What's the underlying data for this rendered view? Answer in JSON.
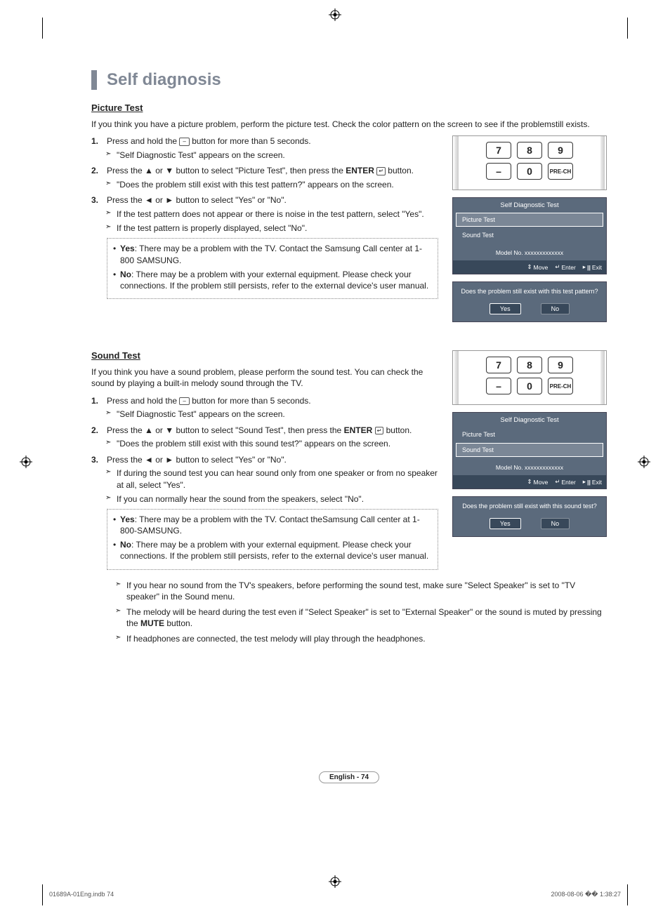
{
  "title": "Self diagnosis",
  "picture": {
    "heading": "Picture Test",
    "intro": "If you think you have a picture problem, perform the picture test. Check the color pattern on the screen to see if the problemstill exists.",
    "step1_prefix": "Press and hold the ",
    "step1_btn": "–",
    "step1_suffix": " button for more than 5 seconds.",
    "step1_sub": "\"Self Diagnostic Test\" appears on the screen.",
    "step2_prefix": "Press the ▲ or ▼ button to select \"Picture Test\", then press the ",
    "step2_enter": "ENTER",
    "step2_suffix": " button.",
    "step2_sub": "\"Does the problem still exist with this test pattern?\" appears on the screen.",
    "step3": "Press the ◄ or ► button to select \"Yes\" or \"No\".",
    "step3_sub1": "If the test pattern does not appear or there is noise in the test pattern, select \"Yes\".",
    "step3_sub2": "If the test pattern is properly displayed, select \"No\".",
    "yes_label": "Yes",
    "yes_text": ": There may be a problem with the TV. Contact the Samsung Call center at 1-800 SAMSUNG.",
    "no_label": "No",
    "no_text": ": There may be a problem with your external equipment. Please check your connections. If the problem still persists, refer to the external device's user manual."
  },
  "sound": {
    "heading": "Sound Test",
    "intro": "If you think you have a sound problem, please perform the sound test. You can check the sound by playing a built-in melody sound through the TV.",
    "step1_prefix": "Press and hold the ",
    "step1_btn": "–",
    "step1_suffix": " button for more than 5 seconds.",
    "step1_sub": "\"Self Diagnostic Test\" appears on the screen.",
    "step2_prefix": "Press the ▲ or ▼ button to select \"Sound Test\", then press the ",
    "step2_enter": "ENTER",
    "step2_suffix": " button.",
    "step2_sub": "\"Does the problem still exist with this sound test?\" appears on the screen.",
    "step3": "Press the ◄ or ► button to select \"Yes\" or \"No\".",
    "step3_sub1": "If during the sound test you can hear sound only from one speaker or from no speaker at all, select \"Yes\".",
    "step3_sub2": "If you can normally hear the sound from the speakers, select \"No\".",
    "yes_label": "Yes",
    "yes_text": ": There may be a problem with the TV. Contact theSamsung Call center at 1-800-SAMSUNG.",
    "no_label": "No",
    "no_text": ": There may be a problem with your external equipment. Please check your connections. If the problem still persists, refer to the external device's user manual.",
    "note1": "If you hear no sound from the TV's speakers, before performing the sound test, make sure \"Select Speaker\" is set to \"TV speaker\" in the Sound menu.",
    "note2_prefix": "The melody will be heard during the test even if \"Select Speaker\" is set to \"External Speaker\" or the sound is muted by pressing the ",
    "note2_mute": "MUTE",
    "note2_suffix": " button.",
    "note3": "If headphones are connected, the test melody will play through the headphones."
  },
  "remote": {
    "r1": [
      "7",
      "8",
      "9"
    ],
    "r2": [
      "–",
      "0",
      "PRE-CH"
    ]
  },
  "osd": {
    "title": "Self Diagnostic Test",
    "item_picture": "Picture Test",
    "item_sound": "Sound Test",
    "model": "Model No. xxxxxxxxxxxxx",
    "nav_move": "Move",
    "nav_enter": "Enter",
    "nav_exit": "Exit"
  },
  "dialog_picture": {
    "q": "Does the problem still exist with this test pattern?",
    "yes": "Yes",
    "no": "No"
  },
  "dialog_sound": {
    "q": "Does the problem still exist with this sound test?",
    "yes": "Yes",
    "no": "No"
  },
  "footer": {
    "page": "English - 74",
    "file": "01689A-01Eng.indb   74",
    "timestamp": "2008-08-06   �� 1:38:27"
  }
}
